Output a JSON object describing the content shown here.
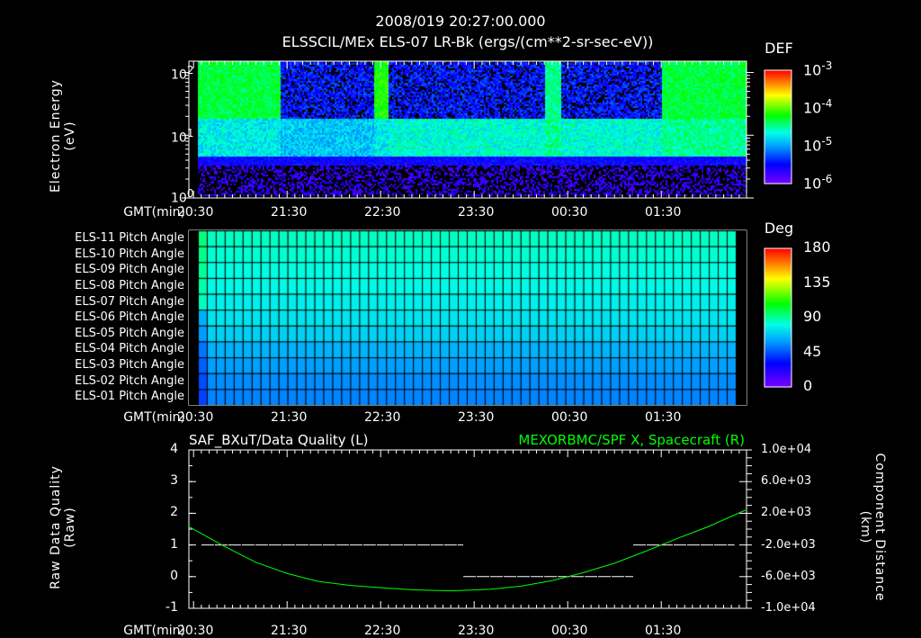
{
  "header": {
    "timestamp": "2008/019 20:27:00.000"
  },
  "time_axis": {
    "label": "GMT(min)",
    "ticks": [
      "20:30",
      "21:30",
      "22:30",
      "23:30",
      "00:30",
      "01:30"
    ]
  },
  "chart_data": [
    {
      "type": "heatmap",
      "title": "ELSSCIL/MEx ELS-07 LR-Bk  (ergs/(cm**2-sr-sec-eV))",
      "ylabel_line1": "Electron Energy",
      "ylabel_line2": "(eV)",
      "yticks": [
        "10^2",
        "10^1",
        "10^0"
      ],
      "ylim": [
        1,
        150
      ],
      "yscale": "log",
      "colorbar": {
        "label": "DEF",
        "ticks": [
          "10^-3",
          "10^-4",
          "10^-5",
          "10^-6"
        ],
        "range": [
          1e-06,
          0.001
        ]
      }
    },
    {
      "type": "heatmap",
      "rows": [
        "ELS-11 Pitch Angle",
        "ELS-10 Pitch Angle",
        "ELS-09 Pitch Angle",
        "ELS-08 Pitch Angle",
        "ELS-07 Pitch Angle",
        "ELS-06 Pitch Angle",
        "ELS-05 Pitch Angle",
        "ELS-04 Pitch Angle",
        "ELS-03 Pitch Angle",
        "ELS-02 Pitch Angle",
        "ELS-01 Pitch Angle"
      ],
      "row_values_deg": [
        100,
        98,
        96,
        94,
        91,
        88,
        83,
        75,
        70,
        66,
        64
      ],
      "colorbar": {
        "label": "Deg",
        "ticks": [
          "180",
          "135",
          "90",
          "45",
          "0"
        ],
        "range": [
          0,
          180
        ]
      }
    },
    {
      "type": "line",
      "title_left": "SAF_BXuT/Data Quality (L)",
      "title_right": "MEXORBMC/SPF X, Spacecraft (R)",
      "ylabel_left_line1": "Raw Data Quality",
      "ylabel_left_line2": "(Raw)",
      "ylabel_right_line1": "Component Distance",
      "ylabel_right_line2": "(km)",
      "yticks_left": [
        "4",
        "3",
        "2",
        "1",
        "0",
        "-1"
      ],
      "ylim_left": [
        -1,
        4
      ],
      "yticks_right": [
        "1.0e+04",
        "6.0e+03",
        "2.0e+03",
        "-2.0e+03",
        "-6.0e+03",
        "-1.0e+04"
      ],
      "ylim_right": [
        -10000,
        10000
      ],
      "x_unit": "minutes since 20:30",
      "xlim": [
        -3,
        354
      ],
      "series": [
        {
          "name": "Data Quality",
          "axis": "left",
          "color": "#ffffff",
          "segments": [
            {
              "x": [
                5,
                173
              ],
              "y": 1
            },
            {
              "x": [
                173,
                282
              ],
              "y": 0
            },
            {
              "x": [
                282,
                347
              ],
              "y": 1
            }
          ]
        },
        {
          "name": "SPF X",
          "axis": "right",
          "color": "#00ff00",
          "x": [
            -3,
            20,
            40,
            60,
            80,
            100,
            120,
            140,
            165,
            190,
            210,
            230,
            250,
            270,
            290,
            310,
            330,
            354
          ],
          "y": [
            300,
            -2200,
            -4200,
            -5600,
            -6600,
            -7100,
            -7400,
            -7650,
            -7800,
            -7600,
            -7200,
            -6500,
            -5500,
            -4300,
            -2800,
            -1200,
            300,
            2400
          ]
        }
      ]
    }
  ]
}
